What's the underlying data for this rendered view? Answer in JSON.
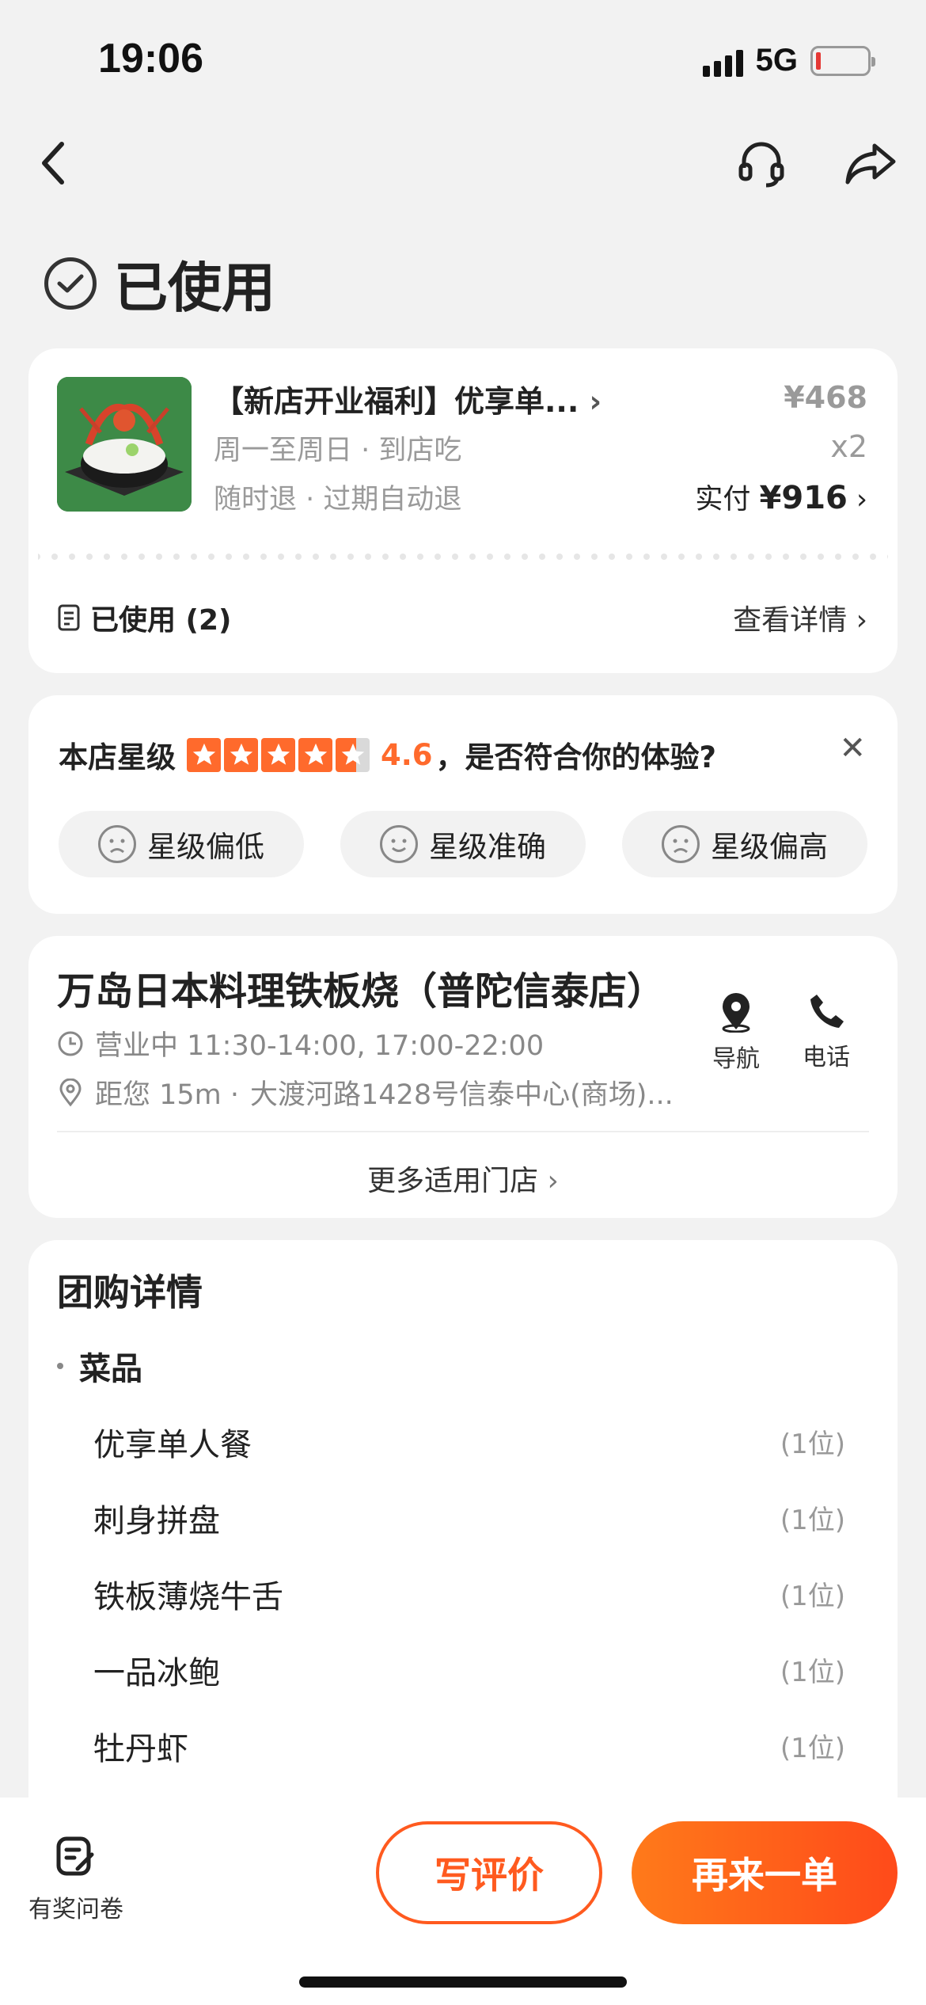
{
  "status_bar": {
    "time": "19:06",
    "network": "5G"
  },
  "page": {
    "title": "已使用"
  },
  "order": {
    "product_name": "【新店开业福利】优享单...",
    "schedule": "周一至周日 · 到店吃",
    "refund_policy": "随时退 · 过期自动退",
    "original_price": "¥468",
    "quantity": "x2",
    "paid_label": "实付 ",
    "paid_amount": "¥916",
    "used_status": "已使用 (2)",
    "view_details": "查看详情"
  },
  "rating": {
    "label": "本店星级",
    "score": "4.6",
    "question": "，是否符合你的体验?",
    "star_count": 4.6,
    "options": [
      "星级偏低",
      "星级准确",
      "星级偏高"
    ]
  },
  "store": {
    "name": "万岛日本料理铁板烧（普陀信泰店）",
    "hours": "营业中 11:30-14:00, 17:00-22:00",
    "distance": "距您 15m ·",
    "address": "大渡河路1428号信泰中心(商场)...",
    "nav_label": "导航",
    "phone_label": "电话",
    "more_stores": "更多适用门店"
  },
  "deal": {
    "title": "团购详情",
    "category": "菜品",
    "dishes": [
      {
        "name": "优享单人餐",
        "qty": "(1位)"
      },
      {
        "name": "刺身拼盘",
        "qty": "(1位)"
      },
      {
        "name": "铁板薄烧牛舌",
        "qty": "(1位)"
      },
      {
        "name": "一品冰鲍",
        "qty": "(1位)"
      },
      {
        "name": "牡丹虾",
        "qty": "(1位)"
      }
    ]
  },
  "bottom": {
    "survey_label": "有奖问卷",
    "review_button": "写评价",
    "reorder_button": "再来一单"
  },
  "colors": {
    "accent": "#ff5a1f",
    "star": "#ff6a2c",
    "background": "#f2f2f2"
  },
  "icons": [
    "back-icon",
    "headset-icon",
    "share-icon",
    "check-circle-icon",
    "chevron-right-icon",
    "receipt-icon",
    "close-icon",
    "face-sad-icon",
    "face-smile-icon",
    "clock-icon",
    "location-pin-icon",
    "navigation-icon",
    "phone-icon",
    "survey-edit-icon"
  ]
}
